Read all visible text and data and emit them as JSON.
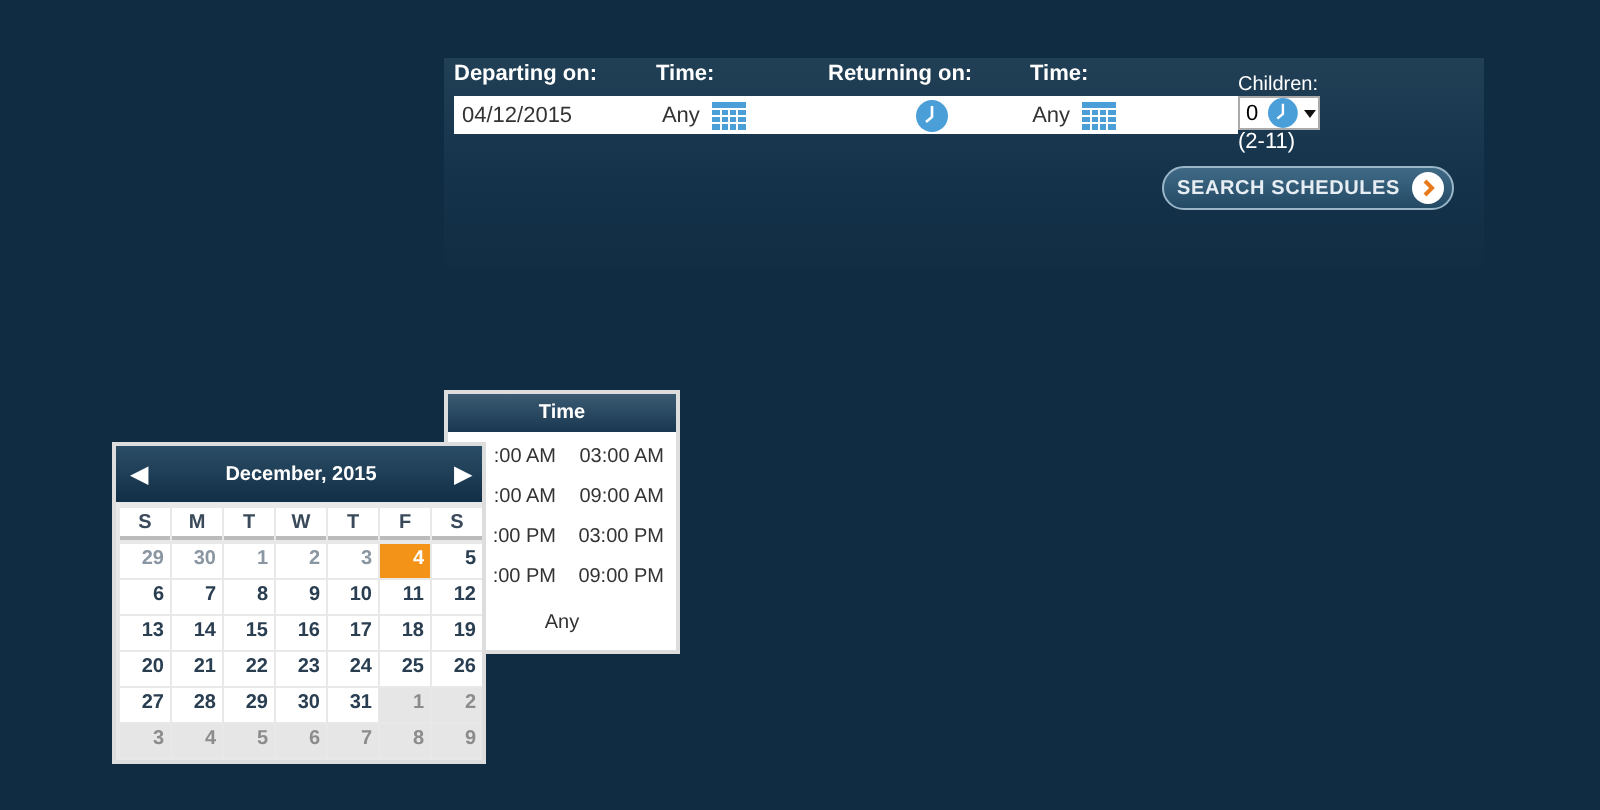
{
  "search_form": {
    "departing_label": "Departing on:",
    "departing_date": "04/12/2015",
    "departing_time_label": "Time:",
    "departing_time": "Any",
    "returning_label": "Returning on:",
    "returning_time_label": "Time:",
    "returning_time": "Any",
    "children_label": "Children:",
    "children_value": "0",
    "children_range": "(2-11)",
    "search_button": "SEARCH SCHEDULES"
  },
  "time_popup": {
    "title": "Time",
    "options": [
      {
        "label": ":00 AM",
        "selected": false
      },
      {
        "label": "03:00 AM",
        "selected": false
      },
      {
        "label": ":00 AM",
        "selected": false
      },
      {
        "label": "09:00 AM",
        "selected": false
      },
      {
        "label": ":00 PM",
        "selected": false
      },
      {
        "label": "03:00 PM",
        "selected": false
      },
      {
        "label": ":00 PM",
        "selected": false
      },
      {
        "label": "09:00 PM",
        "selected": false
      }
    ],
    "any": "Any"
  },
  "calendar": {
    "prev": "◀",
    "title": "December, 2015",
    "next": "▶",
    "weekdays": [
      "S",
      "M",
      "T",
      "W",
      "T",
      "F",
      "S"
    ],
    "days": [
      {
        "label": "29",
        "kind": "disabled",
        "selected": false
      },
      {
        "label": "30",
        "kind": "disabled",
        "selected": false
      },
      {
        "label": "1",
        "kind": "disabled",
        "selected": false
      },
      {
        "label": "2",
        "kind": "disabled",
        "selected": false
      },
      {
        "label": "3",
        "kind": "disabled",
        "selected": false
      },
      {
        "label": "4",
        "kind": "normal",
        "selected": true
      },
      {
        "label": "5",
        "kind": "normal",
        "selected": false
      },
      {
        "label": "6",
        "kind": "normal",
        "selected": false
      },
      {
        "label": "7",
        "kind": "normal",
        "selected": false
      },
      {
        "label": "8",
        "kind": "normal",
        "selected": false
      },
      {
        "label": "9",
        "kind": "normal",
        "selected": false
      },
      {
        "label": "10",
        "kind": "normal",
        "selected": false
      },
      {
        "label": "11",
        "kind": "normal",
        "selected": false
      },
      {
        "label": "12",
        "kind": "normal",
        "selected": false
      },
      {
        "label": "13",
        "kind": "normal",
        "selected": false
      },
      {
        "label": "14",
        "kind": "normal",
        "selected": false
      },
      {
        "label": "15",
        "kind": "normal",
        "selected": false
      },
      {
        "label": "16",
        "kind": "normal",
        "selected": false
      },
      {
        "label": "17",
        "kind": "normal",
        "selected": false
      },
      {
        "label": "18",
        "kind": "normal",
        "selected": false
      },
      {
        "label": "19",
        "kind": "normal",
        "selected": false
      },
      {
        "label": "20",
        "kind": "normal",
        "selected": false
      },
      {
        "label": "21",
        "kind": "normal",
        "selected": false
      },
      {
        "label": "22",
        "kind": "normal",
        "selected": false
      },
      {
        "label": "23",
        "kind": "normal",
        "selected": false
      },
      {
        "label": "24",
        "kind": "normal",
        "selected": false
      },
      {
        "label": "25",
        "kind": "normal",
        "selected": false
      },
      {
        "label": "26",
        "kind": "normal",
        "selected": false
      },
      {
        "label": "27",
        "kind": "normal",
        "selected": false
      },
      {
        "label": "28",
        "kind": "normal",
        "selected": false
      },
      {
        "label": "29",
        "kind": "normal",
        "selected": false
      },
      {
        "label": "30",
        "kind": "normal",
        "selected": false
      },
      {
        "label": "31",
        "kind": "normal",
        "selected": false
      },
      {
        "label": "1",
        "kind": "outside",
        "selected": false
      },
      {
        "label": "2",
        "kind": "outside",
        "selected": false
      },
      {
        "label": "3",
        "kind": "outside",
        "selected": false
      },
      {
        "label": "4",
        "kind": "outside",
        "selected": false
      },
      {
        "label": "5",
        "kind": "outside",
        "selected": false
      },
      {
        "label": "6",
        "kind": "outside",
        "selected": false
      },
      {
        "label": "7",
        "kind": "outside",
        "selected": false
      },
      {
        "label": "8",
        "kind": "outside",
        "selected": false
      },
      {
        "label": "9",
        "kind": "outside",
        "selected": false
      }
    ]
  }
}
